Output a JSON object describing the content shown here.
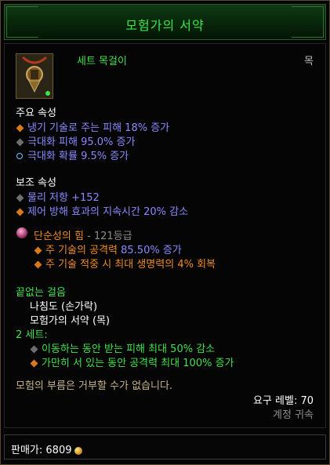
{
  "title": "모험가의 서약",
  "item_type": "세트 목걸이",
  "slot": "목",
  "primary": {
    "heading": "주요 속성",
    "stats": [
      {
        "text": "냉기 기술로 주는 피해 18% 증가",
        "bullet": "orange"
      },
      {
        "text": "극대화 피해 95.0% 증가",
        "bullet": "gray"
      },
      {
        "text": "극대화 확률 9.5% 증가",
        "bullet": "ring"
      }
    ]
  },
  "secondary": {
    "heading": "보조 속성",
    "stats": [
      {
        "text": "물리 저항 +152",
        "bullet": "gray"
      },
      {
        "text": "제어 방해 효과의 지속시간 20% 감소",
        "bullet": "orange"
      }
    ]
  },
  "legendary_gem": {
    "name": "단순성의 힘",
    "rank": " - 121등급",
    "effects": [
      {
        "prefix": "주 기술의 공격력 ",
        "value": "85.50% 증가"
      },
      {
        "prefix": "주 기술 적중 시 최대 생명력의 4% 회복",
        "value": ""
      }
    ]
  },
  "set": {
    "name": "끝없는 걸음",
    "pieces": [
      "나침도 (손가락)",
      "모험가의 서약 (목)"
    ],
    "bonus_header": "2 세트:",
    "bonuses": [
      "이동하는 동안 받는 피해 최대 50% 감소",
      "가만히 서 있는 동안 공격력 최대 100% 증가"
    ]
  },
  "flavor": "모험의 부름은 거부할 수가 없습니다.",
  "required_level": "요구 레벨: 70",
  "account_bound": "계정 귀속",
  "price_label": "판매가: ",
  "price_value": "6809",
  "colors": {
    "set_green": "#3fe34a",
    "magic_blue": "#8a8aff",
    "orange": "#f08c1c"
  }
}
